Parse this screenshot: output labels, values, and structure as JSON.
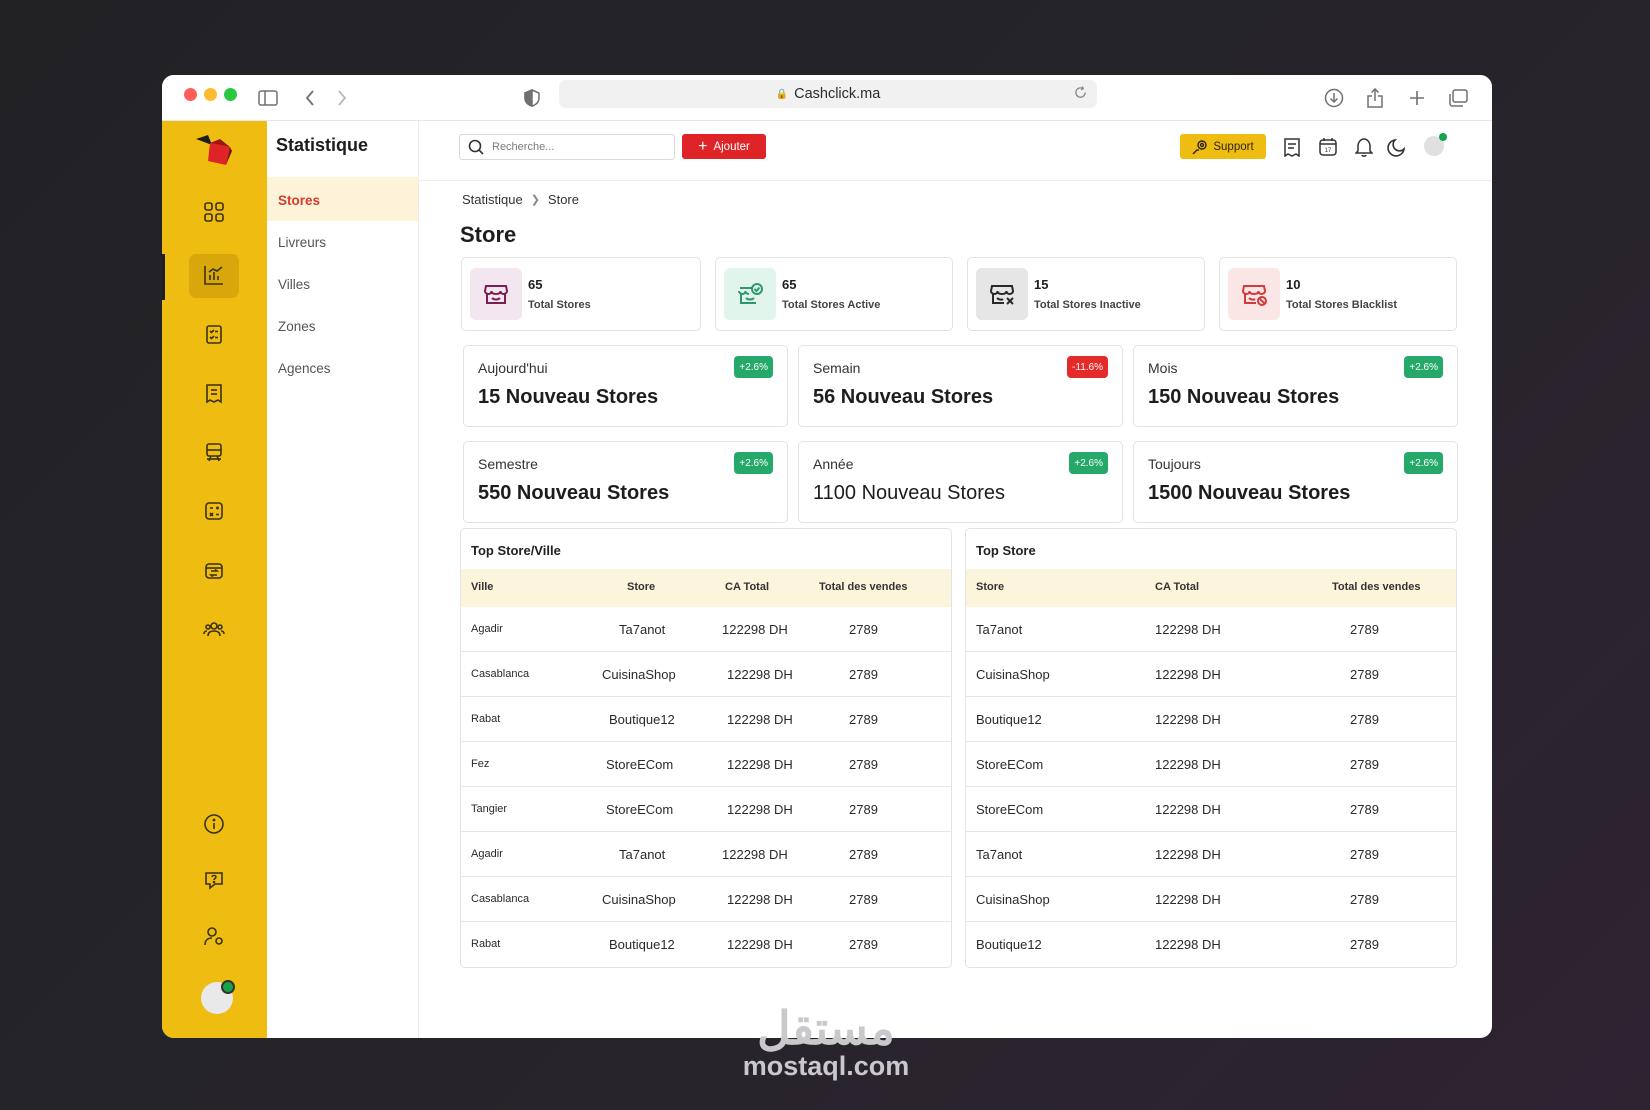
{
  "browser": {
    "url": "Cashclick.ma"
  },
  "sidebar": {
    "title": "Statistique",
    "items": [
      "Stores",
      "Livreurs",
      "Villes",
      "Zones",
      "Agences"
    ]
  },
  "topbar": {
    "search_placeholder": "Recherche...",
    "add_label": "Ajouter",
    "support_label": "Support"
  },
  "breadcrumb": {
    "items": [
      "Statistique",
      "Store"
    ]
  },
  "page": {
    "title": "Store"
  },
  "kpis": [
    {
      "value": "65",
      "label": "Total Stores",
      "bg": "#f3e6ee",
      "color": "#7a1f55",
      "icon": "store-icon"
    },
    {
      "value": "65",
      "label": "Total Stores Active",
      "bg": "#e1f5ec",
      "color": "#2e9a6c",
      "icon": "store-check-icon"
    },
    {
      "value": "15",
      "label": "Total Stores Inactive",
      "bg": "#e6e6e6",
      "color": "#2a2a2a",
      "icon": "store-x-icon"
    },
    {
      "value": "10",
      "label": "Total Stores Blacklist",
      "bg": "#fbe6e6",
      "color": "#d33a3a",
      "icon": "store-blocked-icon"
    }
  ],
  "stats": [
    {
      "label": "Aujourd'hui",
      "value": "15 Nouveau Stores",
      "badge": "+2.6%",
      "badge_color": "#25a86a"
    },
    {
      "label": "Semain",
      "value": "56 Nouveau Stores",
      "badge": "-11.6%",
      "badge_color": "#e52a2a"
    },
    {
      "label": "Mois",
      "value": "150 Nouveau Stores",
      "badge": "+2.6%",
      "badge_color": "#25a86a"
    },
    {
      "label": "Semestre",
      "value": "550 Nouveau Stores",
      "badge": "+2.6%",
      "badge_color": "#25a86a"
    },
    {
      "label": "Année",
      "value": "1100 Nouveau Stores",
      "badge": "+2.6%",
      "badge_color": "#25a86a"
    },
    {
      "label": "Toujours",
      "value": "1500 Nouveau Stores",
      "badge": "+2.6%",
      "badge_color": "#25a86a"
    }
  ],
  "table_ville": {
    "title": "Top Store/Ville",
    "headers": [
      "Ville",
      "Store",
      "CA Total",
      "Total des vendes"
    ],
    "rows": [
      [
        "Agadir",
        "Ta7anot",
        "122298 DH",
        "2789"
      ],
      [
        "Casablanca",
        "CuisinaShop",
        "122298 DH",
        "2789"
      ],
      [
        "Rabat",
        "Boutique12",
        "122298 DH",
        "2789"
      ],
      [
        "Fez",
        "StoreECom",
        "122298 DH",
        "2789"
      ],
      [
        "Tangier",
        "StoreECom",
        "122298 DH",
        "2789"
      ],
      [
        "Agadir",
        "Ta7anot",
        "122298 DH",
        "2789"
      ],
      [
        "Casablanca",
        "CuisinaShop",
        "122298 DH",
        "2789"
      ],
      [
        "Rabat",
        "Boutique12",
        "122298 DH",
        "2789"
      ]
    ]
  },
  "table_store": {
    "title": "Top Store",
    "headers": [
      "Store",
      "CA Total",
      "Total des vendes"
    ],
    "rows": [
      [
        "Ta7anot",
        "122298 DH",
        "2789"
      ],
      [
        "CuisinaShop",
        "122298 DH",
        "2789"
      ],
      [
        "Boutique12",
        "122298 DH",
        "2789"
      ],
      [
        "StoreECom",
        "122298 DH",
        "2789"
      ],
      [
        "StoreECom",
        "122298 DH",
        "2789"
      ],
      [
        "Ta7anot",
        "122298 DH",
        "2789"
      ],
      [
        "CuisinaShop",
        "122298 DH",
        "2789"
      ],
      [
        "Boutique12",
        "122298 DH",
        "2789"
      ]
    ]
  },
  "watermark": {
    "arabic": "مستقل",
    "latin": "mostaql.com"
  },
  "colors": {
    "accent": "#efbd11",
    "primary_red": "#de2426",
    "active_text": "#d73b2e"
  }
}
